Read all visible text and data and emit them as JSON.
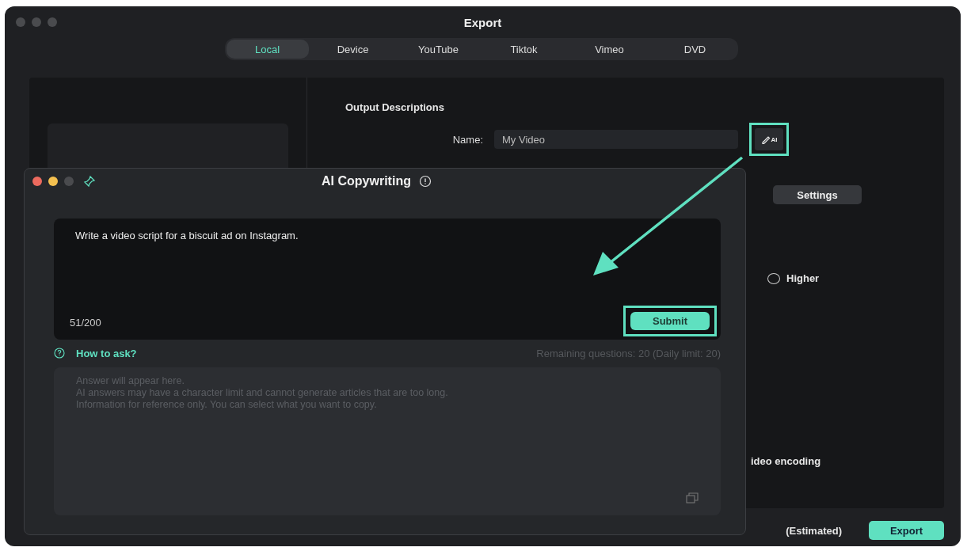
{
  "export_window": {
    "title": "Export",
    "tabs": [
      {
        "label": "Local",
        "selected": true
      },
      {
        "label": "Device",
        "selected": false
      },
      {
        "label": "YouTube",
        "selected": false
      },
      {
        "label": "Tiktok",
        "selected": false
      },
      {
        "label": "Vimeo",
        "selected": false
      },
      {
        "label": "DVD",
        "selected": false
      }
    ],
    "output": {
      "heading": "Output Descriptions",
      "name_label": "Name:",
      "name_value": "My Video",
      "ai_button": "AI"
    },
    "settings_button": "Settings",
    "quality_option": {
      "label": "Higher",
      "selected": false
    },
    "encoding_label": "ideo encoding",
    "size_estimate": "(Estimated)",
    "export_button": "Export"
  },
  "ai_dialog": {
    "title": "AI Copywriting",
    "prompt": "Write a video script for a biscuit ad on Instagram.",
    "counter": "51/200",
    "submit_button": "Submit",
    "help_link": "How to ask?",
    "remaining": "Remaining questions: 20 (Daily limit:  20)",
    "answer_placeholder": "Answer will appear here.\nAI answers may have a character limit and cannot generate articles that are too long.\nInformation for reference only. You can select what you want to copy."
  }
}
